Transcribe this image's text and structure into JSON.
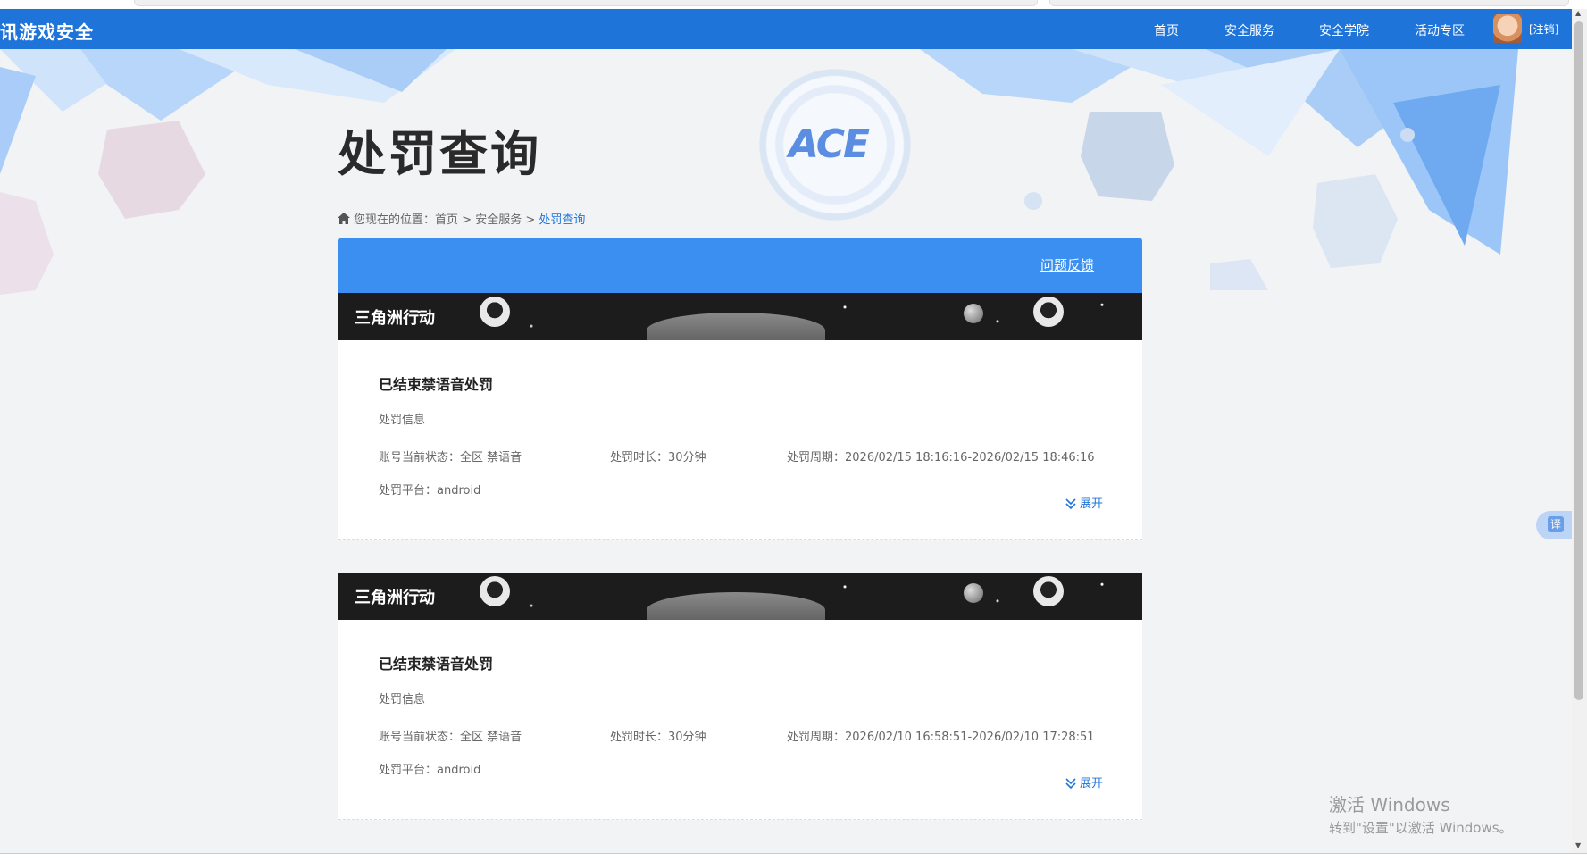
{
  "header": {
    "logo_text": "讯游戏安全",
    "nav_items": [
      "首页",
      "安全服务",
      "安全学院",
      "活动专区"
    ],
    "logout_label": "[注销]"
  },
  "page": {
    "title": "处罚查询",
    "emblem_text": "ACE"
  },
  "breadcrumb": {
    "prefix": "您现在的位置：",
    "items": [
      "首页",
      "安全服务",
      "处罚查询"
    ],
    "separator": ">"
  },
  "feedback_label": "问题反馈",
  "records": [
    {
      "game": "三角洲行动",
      "status_title": "已结束禁语音处罚",
      "section_label": "处罚信息",
      "account_status": "账号当前状态：全区 禁语音",
      "duration": "处罚时长：30分钟",
      "period": "处罚周期：2026/02/15 18:16:16-2026/02/15 18:46:16",
      "platform": "处罚平台：android",
      "expand_label": "展开"
    },
    {
      "game": "三角洲行动",
      "status_title": "已结束禁语音处罚",
      "section_label": "处罚信息",
      "account_status": "账号当前状态：全区 禁语音",
      "duration": "处罚时长：30分钟",
      "period": "处罚周期：2026/02/10 16:58:51-2026/02/10 17:28:51",
      "platform": "处罚平台：android",
      "expand_label": "展开"
    }
  ],
  "translate_label": "译",
  "windows_watermark": {
    "line1": "激活 Windows",
    "line2": "转到\"设置\"以激活 Windows。"
  },
  "colors": {
    "nav_blue": "#1f74d9",
    "bar_blue": "#3b8ff0",
    "accent_link": "#1f74d9"
  },
  "icons": [
    "home-icon",
    "chevron-double-down-icon",
    "avatar"
  ]
}
